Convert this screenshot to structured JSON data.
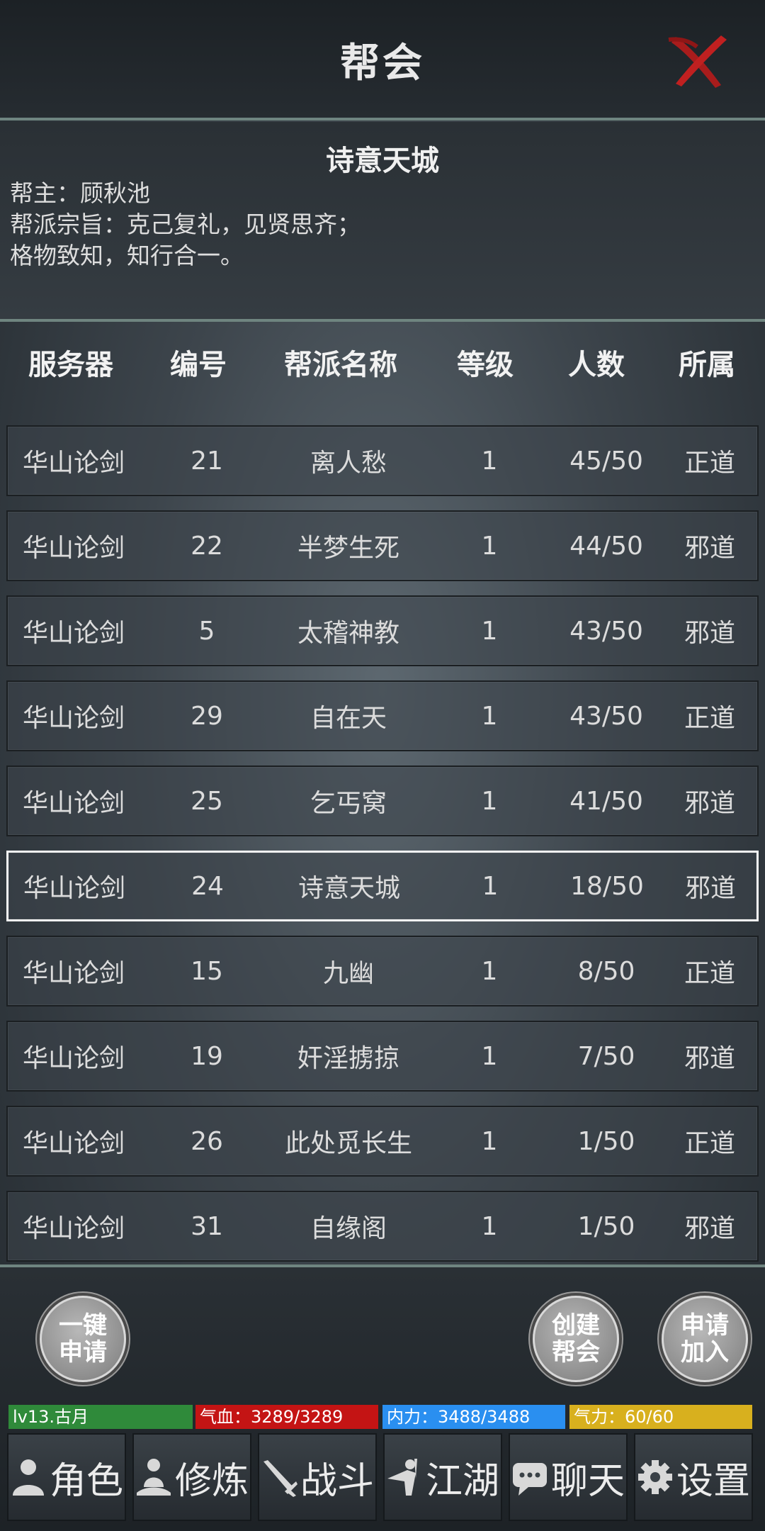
{
  "header": {
    "title": "帮会"
  },
  "guild": {
    "name": "诗意天城",
    "leader_line": "帮主：顾秋池",
    "motto_line1": "帮派宗旨：克己复礼，见贤思齐；",
    "motto_line2": "格物致知，知行合一。"
  },
  "table": {
    "columns": [
      "服务器",
      "编号",
      "帮派名称",
      "等级",
      "人数",
      "所属"
    ],
    "rows": [
      [
        "华山论剑",
        "21",
        "离人愁",
        "1",
        "45/50",
        "正道"
      ],
      [
        "华山论剑",
        "22",
        "半梦生死",
        "1",
        "44/50",
        "邪道"
      ],
      [
        "华山论剑",
        "5",
        "太稽神教",
        "1",
        "43/50",
        "邪道"
      ],
      [
        "华山论剑",
        "29",
        "自在天",
        "1",
        "43/50",
        "正道"
      ],
      [
        "华山论剑",
        "25",
        "乞丐窝",
        "1",
        "41/50",
        "邪道"
      ],
      [
        "华山论剑",
        "24",
        "诗意天城",
        "1",
        "18/50",
        "邪道"
      ],
      [
        "华山论剑",
        "15",
        "九幽",
        "1",
        "8/50",
        "正道"
      ],
      [
        "华山论剑",
        "19",
        "奸淫掳掠",
        "1",
        "7/50",
        "邪道"
      ],
      [
        "华山论剑",
        "26",
        "此处觅长生",
        "1",
        "1/50",
        "正道"
      ],
      [
        "华山论剑",
        "31",
        "自缘阁",
        "1",
        "1/50",
        "邪道"
      ]
    ],
    "selected_row": 5
  },
  "actions": {
    "quick_apply_line1": "一键",
    "quick_apply_line2": "申请",
    "create_line1": "创建",
    "create_line2": "帮会",
    "join_line1": "申请",
    "join_line2": "加入"
  },
  "stats": {
    "level": "lv13.古月",
    "hp": "气血：3289/3289",
    "mp": "内力：3488/3488",
    "stamina": "气力：60/60",
    "colors": {
      "level": "#2f8a3a",
      "hp": "#c41414",
      "mp": "#2a8ff0",
      "stamina": "#d8b01e"
    }
  },
  "nav": {
    "items": [
      {
        "label": "角色",
        "icon": "person-icon"
      },
      {
        "label": "修炼",
        "icon": "meditate-icon"
      },
      {
        "label": "战斗",
        "icon": "sword-icon"
      },
      {
        "label": "江湖",
        "icon": "swordsman-icon"
      },
      {
        "label": "聊天",
        "icon": "chat-icon"
      },
      {
        "label": "设置",
        "icon": "gear-icon"
      }
    ]
  }
}
